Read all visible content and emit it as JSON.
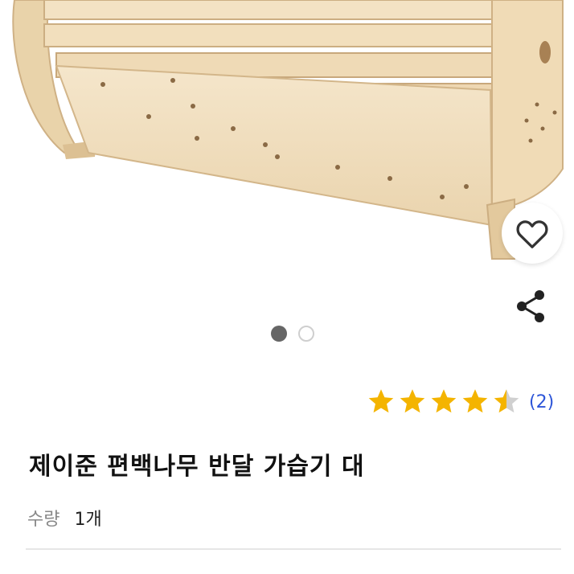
{
  "product": {
    "title": "제이준 편백나무 반달 가습기 대",
    "quantity_label": "수량",
    "quantity_value": "1개"
  },
  "rating": {
    "stars": 4.5,
    "max_stars": 5,
    "review_count": "(2)"
  },
  "gallery": {
    "total_images": 2,
    "active_index": 0
  },
  "actions": {
    "favorite_icon": "heart-icon",
    "share_icon": "share-icon"
  },
  "colors": {
    "star": "#f4b400",
    "star_empty": "#d0d0d0",
    "review_link": "#2d55d8",
    "wood_light": "#f1dfc0",
    "wood_dark": "#c9a97f"
  }
}
